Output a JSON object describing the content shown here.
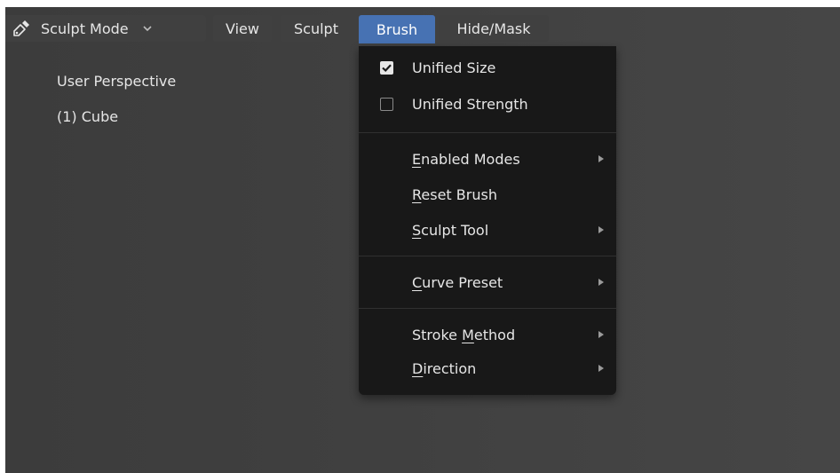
{
  "header": {
    "mode_label": "Sculpt Mode",
    "mode_icon": "sculpt-brush-icon",
    "menus": [
      {
        "label": "View"
      },
      {
        "label": "Sculpt"
      },
      {
        "label": "Brush",
        "active": true
      },
      {
        "label": "Hide/Mask"
      }
    ]
  },
  "viewport": {
    "perspective_label": "User Perspective",
    "object_label": "(1) Cube"
  },
  "brush_menu": {
    "items": [
      {
        "label": "Unified Size",
        "checked": true
      },
      {
        "label": "Unified Strength",
        "checked": false
      },
      {
        "label": "Enabled Modes",
        "underline": "E",
        "rest": "nabled Modes",
        "submenu": true
      },
      {
        "label": "Reset Brush",
        "underline": "R",
        "rest": "eset Brush",
        "submenu": false
      },
      {
        "label": "Sculpt Tool",
        "underline": "S",
        "rest": "culpt Tool",
        "submenu": true
      },
      {
        "label": "Curve Preset",
        "underline": "C",
        "rest": "urve Preset",
        "submenu": true
      },
      {
        "label": "Stroke Method",
        "pre": "Stroke ",
        "underline": "M",
        "rest": "ethod",
        "submenu": true
      },
      {
        "label": "Direction",
        "underline": "D",
        "rest": "irection",
        "submenu": true
      }
    ]
  },
  "colors": {
    "accent": "#4772b3",
    "menu_bg": "#181818",
    "viewport_bg": "#404040",
    "text": "#e6e6e6"
  }
}
